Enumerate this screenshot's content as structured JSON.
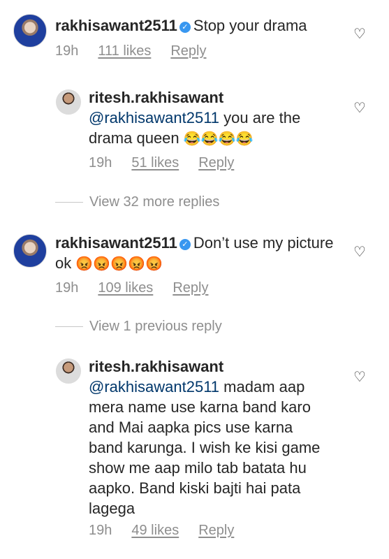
{
  "comments": [
    {
      "username": "rakhisawant2511",
      "verified": true,
      "text": "Stop your drama",
      "time": "19h",
      "likes": "111 likes",
      "reply": "Reply"
    },
    {
      "username": "ritesh.rakhisawant",
      "mention": "@rakhisawant2511",
      "text": " you are the drama queen ",
      "emoji": "😂😂😂😂",
      "time": "19h",
      "likes": "51 likes",
      "reply": "Reply"
    },
    {
      "view_more": "View 32 more replies"
    },
    {
      "username": "rakhisawant2511",
      "verified": true,
      "text": "Don’t use my picture ok ",
      "emoji": "😡😡😡😡😡",
      "time": "19h",
      "likes": "109 likes",
      "reply": "Reply"
    },
    {
      "view_previous": "View 1 previous reply"
    },
    {
      "username": "ritesh.rakhisawant",
      "mention": "@rakhisawant2511",
      "text": " madam aap mera name use karna band karo and Mai aapka pics use karna band karunga. I wish ke kisi game show me aap milo tab batata hu aapko. Band kiski bajti hai pata lagega",
      "time": "19h",
      "likes": "49 likes",
      "reply": "Reply"
    }
  ],
  "icons": {
    "heart": "heart-icon",
    "verified": "verified-badge-icon"
  }
}
